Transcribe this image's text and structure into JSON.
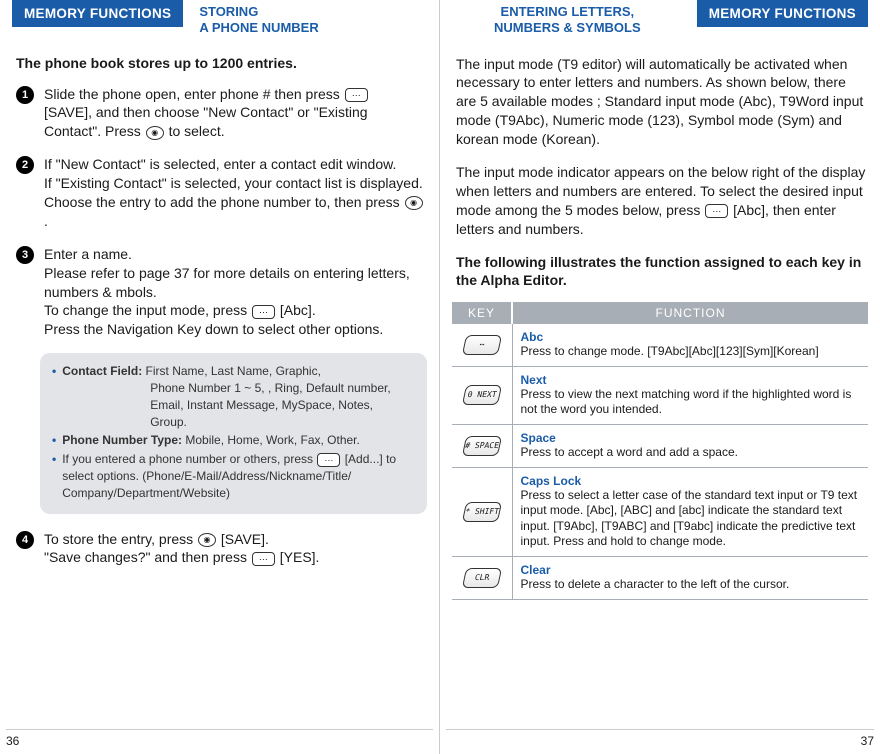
{
  "left": {
    "tab": "MEMORY FUNCTIONS",
    "subtitle_line1": "STORING",
    "subtitle_line2": "A PHONE NUMBER",
    "intro": "The phone book stores up to 1200 entries.",
    "step1_a": "Slide the phone open, enter phone # then press",
    "step1_b": "[SAVE], and then choose \"New Contact\" or \"Existing Contact\". Press",
    "step1_c": "to select.",
    "step2_a": "If \"New Contact\" is selected, enter a contact edit window.",
    "step2_b": "If \"Existing Contact\" is selected, your contact list is displayed. Choose the entry to add the phone number to, then press",
    "step2_c": ".",
    "step3_a": "Enter a name.",
    "step3_b": "Please refer to page 37 for more details on entering letters, numbers & mbols.",
    "step3_c": "To change the input mode, press",
    "step3_d": "[Abc].",
    "step3_e": "Press the Navigation Key down to select other options.",
    "info": {
      "contact_field_label": "Contact Field:",
      "contact_field_1": "First Name, Last Name, Graphic,",
      "contact_field_2": "Phone Number 1 ~ 5, , Ring, Default number,",
      "contact_field_3": "Email, Instant Message, MySpace, Notes,",
      "contact_field_4": "Group.",
      "phone_type_label": "Phone Number Type:",
      "phone_type_vals": "Mobile, Home, Work, Fax, Other.",
      "other_a": "If you entered a phone number or others, press",
      "other_b": "[Add...]",
      "other_c": "to select options. (Phone/E-Mail/Address/Nickname/Title/ Company/Department/Website)"
    },
    "step4_a": "To store the entry, press",
    "step4_b": "[SAVE].",
    "step4_c": "\"Save changes?\" and then press",
    "step4_d": "[YES].",
    "page_num": "36"
  },
  "right": {
    "subtitle_line1": "ENTERING LETTERS,",
    "subtitle_line2": "NUMBERS & SYMBOLS",
    "tab": "MEMORY FUNCTIONS",
    "para1": "The input mode (T9 editor) will automatically be activated when necessary to enter letters and numbers. As shown below, there are 5 available modes ; Standard input mode (Abc), T9Word input mode (T9Abc), Numeric mode (123), Symbol mode (Sym) and korean mode (Korean).",
    "para2_a": "The input mode indicator appears on the below right of the display when letters and numbers are entered. To select the desired input mode among the 5 modes below, press",
    "para2_b": "[Abc], then enter letters and numbers.",
    "bold": "The following illustrates the function assigned to each key in the Alpha Editor.",
    "table": {
      "header_key": "KEY",
      "header_func": "FUNCTION",
      "rows": [
        {
          "key_label": "⋯",
          "name": "Abc",
          "desc": "Press to change mode. [T9Abc][Abc][123][Sym][Korean]"
        },
        {
          "key_label": "0 NEXT",
          "name": "Next",
          "desc": "Press to view the next matching word if the highlighted word is not the word you intended."
        },
        {
          "key_label": "# SPACE",
          "name": "Space",
          "desc": "Press to accept a word and add a space."
        },
        {
          "key_label": "* SHIFT",
          "name": "Caps Lock",
          "desc": "Press to select a letter case of the standard text input or T9 text input mode. [Abc], [ABC] and [abc] indicate the standard text input. [T9Abc], [T9ABC] and [T9abc] indicate the predictive text input. Press and hold to change mode."
        },
        {
          "key_label": "CLR",
          "name": "Clear",
          "desc": "Press to delete a character to the left of the cursor."
        }
      ]
    },
    "page_num": "37"
  }
}
